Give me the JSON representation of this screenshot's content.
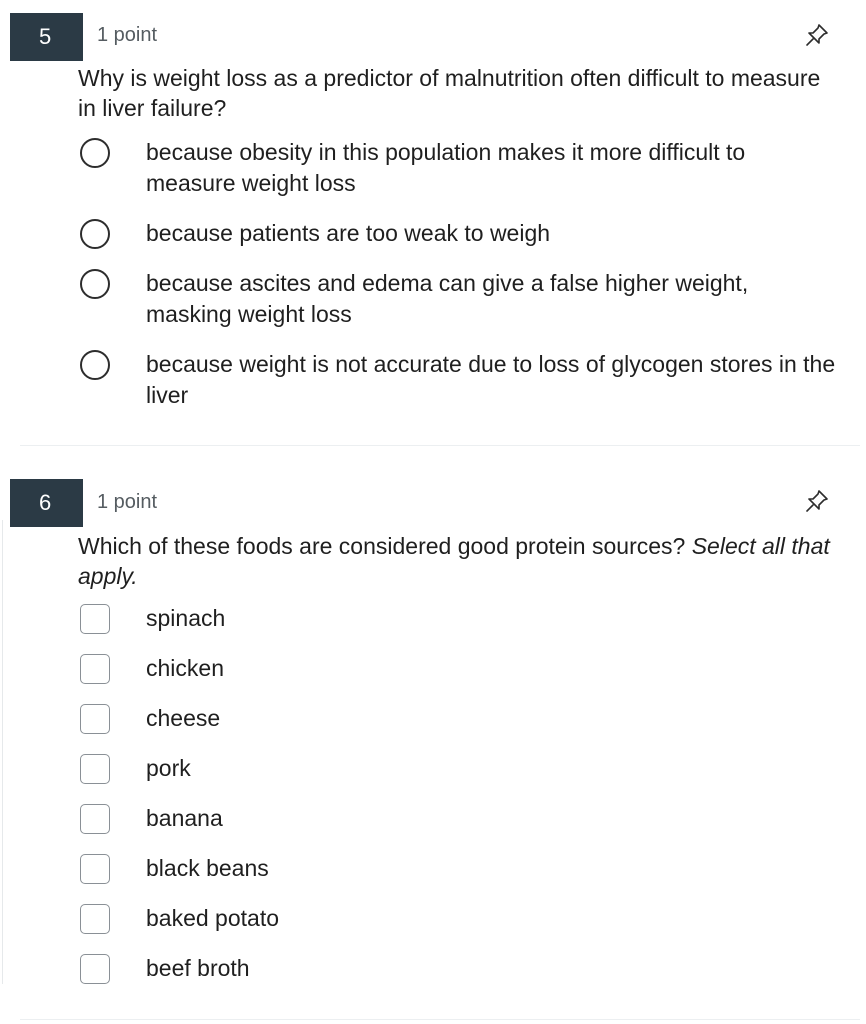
{
  "questions": [
    {
      "number": "5",
      "points": "1 point",
      "text": "Why is weight loss as a predictor of malnutrition often difficult to measure in liver failure?",
      "type": "radio",
      "options": [
        "because obesity in this population makes it more difficult to measure weight loss",
        "because patients are too weak to weigh",
        "because ascites and edema can give a false higher weight, masking weight loss",
        "because weight is not accurate due to loss of glycogen stores in the liver"
      ]
    },
    {
      "number": "6",
      "points": "1 point",
      "text_main": "Which of these foods are considered good protein sources? ",
      "text_emphasis": "Select all that apply.",
      "type": "checkbox",
      "options": [
        "spinach",
        "chicken",
        "cheese",
        "pork",
        "banana",
        "black beans",
        "baked potato",
        "beef broth"
      ]
    }
  ],
  "icons": {
    "pin": "pin-icon",
    "radio": "radio-button",
    "checkbox": "checkbox"
  },
  "colors": {
    "number_badge": "#2b3a45",
    "text": "#1f1f1f",
    "muted": "#555c61"
  }
}
